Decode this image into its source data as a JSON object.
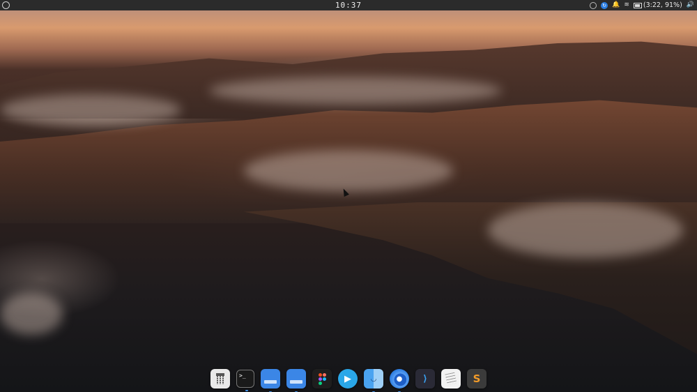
{
  "topbar": {
    "clock": "10:37",
    "battery_text": "(3:22, 91%)"
  },
  "dock": {
    "items": [
      {
        "id": "calculator",
        "icon": "calculator-icon"
      },
      {
        "id": "terminal",
        "icon": "terminal-icon",
        "glyph": ">_"
      },
      {
        "id": "files-1",
        "icon": "files-icon"
      },
      {
        "id": "files-2",
        "icon": "files-icon"
      },
      {
        "id": "figma",
        "icon": "figma-icon"
      },
      {
        "id": "media-player",
        "icon": "play-icon",
        "glyph": "▶"
      },
      {
        "id": "finder",
        "icon": "finder-icon"
      },
      {
        "id": "firefox",
        "icon": "firefox-icon"
      },
      {
        "id": "vscode",
        "icon": "vscode-icon",
        "glyph": "⟩"
      },
      {
        "id": "text-editor",
        "icon": "text-editor-icon"
      },
      {
        "id": "sublime-text",
        "icon": "sublime-text-icon",
        "glyph": "S"
      }
    ]
  },
  "colors": {
    "topbar_bg": "#2b2b2b",
    "accent_blue": "#3d8fe8",
    "sublime_orange": "#f39c29"
  }
}
